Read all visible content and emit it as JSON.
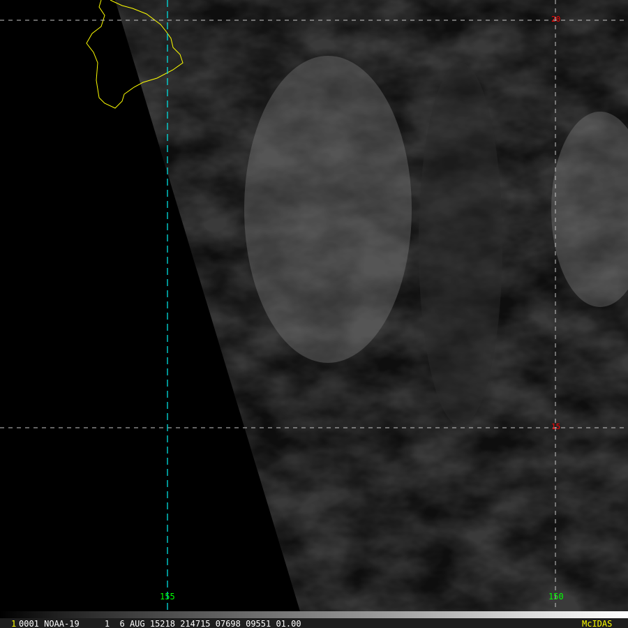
{
  "colors": {
    "grid_lon_155": "#00e0e0",
    "grid": "#c8c8c8",
    "lon_label": "#00ff00",
    "lat_label": "#ff0000",
    "coast": "#ffff00",
    "branding": "#ffff00"
  },
  "grid_labels": {
    "lon": [
      "155",
      "150"
    ],
    "lat": [
      "20",
      "15"
    ]
  },
  "status": {
    "frame": "1",
    "text": "0001 NOAA-19     1  6 AUG 15218 214715 07698 09551 01.00",
    "brand": "McIDAS"
  }
}
